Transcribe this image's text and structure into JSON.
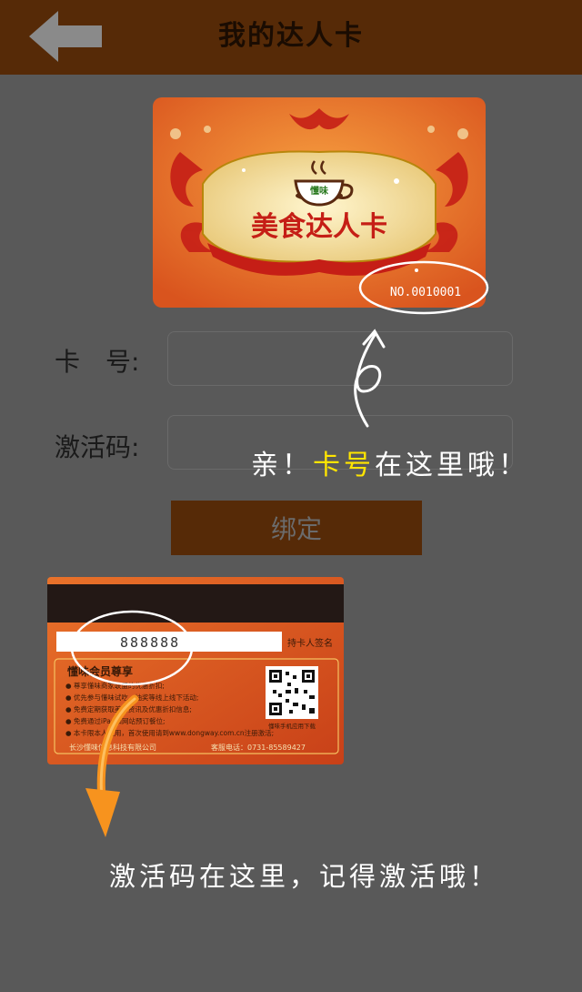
{
  "header": {
    "title": "我的达人卡",
    "back_icon": "back-arrow-icon"
  },
  "card_front": {
    "title": "美食达人卡",
    "logo_text": "懂味",
    "number": "NO.0010001"
  },
  "form": {
    "card_number_label": "卡　号:",
    "card_number_value": "",
    "activation_label": "激活码:",
    "activation_value": "",
    "bind_button": "绑定"
  },
  "hints": {
    "card_number_prefix": "亲！",
    "card_number_highlight": "卡号",
    "card_number_suffix": "在这里哦！",
    "activation": "激活码在这里，记得激活哦！"
  },
  "card_back": {
    "activation_code": "888888",
    "signature_label": "持卡人签名",
    "heading": "懂味会员尊享",
    "benefits": [
      "● 尊享懂味商家联盟的优惠折扣;",
      "● 优先参与懂味试吃、抽奖等线上线下活动;",
      "● 免费定期获取美食资讯及优惠折扣信息;",
      "● 免费通过iPad和网站预订餐位;",
      "● 本卡限本人使用，首次使用请到www.dongway.com.cn注册激活;"
    ],
    "qr_caption": "懂味手机应用下载",
    "company": "长沙懂味信息科技有限公司",
    "hotline": "客服电话：0731-85589427"
  },
  "colors": {
    "background": "#595959",
    "header": "#562a07",
    "highlight": "#ffe500",
    "card_orange": "#e9722a"
  }
}
